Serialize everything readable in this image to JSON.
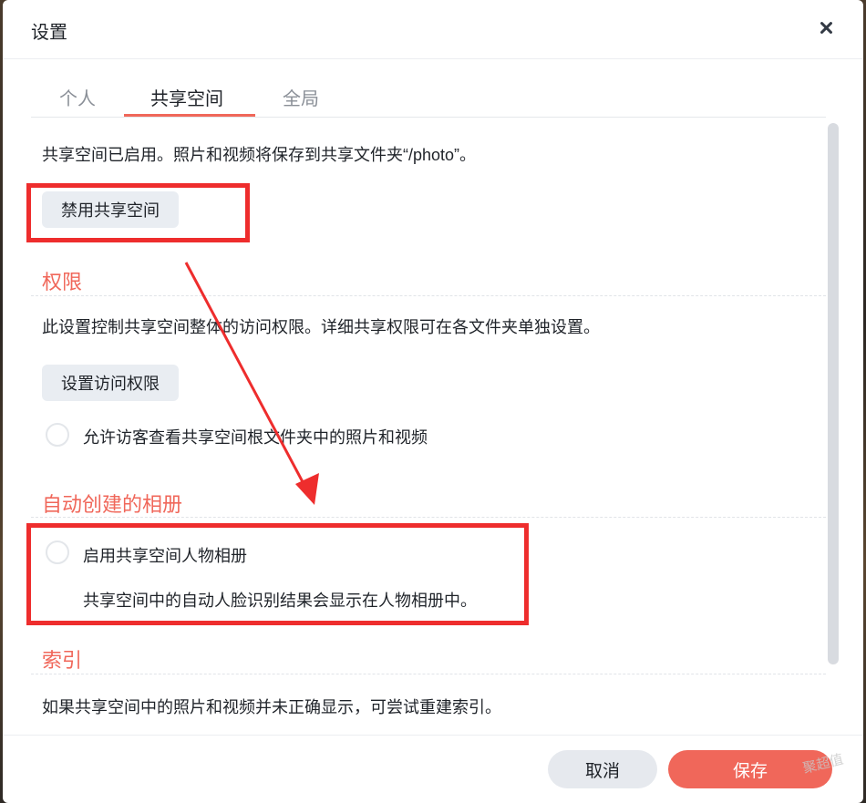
{
  "dialog": {
    "title": "设置",
    "close_icon": "close-icon"
  },
  "tabs": [
    {
      "label": "个人",
      "active": false
    },
    {
      "label": "共享空间",
      "active": true
    },
    {
      "label": "全局",
      "active": false
    }
  ],
  "shared": {
    "status_text": "共享空间已启用。照片和视频将保存到共享文件夹“/photo”。",
    "disable_button": "禁用共享空间"
  },
  "permissions": {
    "title": "权限",
    "description": "此设置控制共享空间整体的访问权限。详细共享权限可在各文件夹单独设置。",
    "set_button": "设置访问权限",
    "guest_option": "允许访客查看共享空间根文件夹中的照片和视频",
    "guest_checked": false
  },
  "auto_albums": {
    "title": "自动创建的相册",
    "people_option": "启用共享空间人物相册",
    "people_checked": false,
    "people_hint": "共享空间中的自动人脸识别结果会显示在人物相册中。"
  },
  "index": {
    "title": "索引",
    "description": "如果共享空间中的照片和视频并未正确显示，可尝试重建索引。"
  },
  "footer": {
    "cancel": "取消",
    "save": "保存"
  },
  "watermark": "聚超值",
  "colors": {
    "accent": "#f0675a",
    "annotation": "#ee2d2d"
  }
}
